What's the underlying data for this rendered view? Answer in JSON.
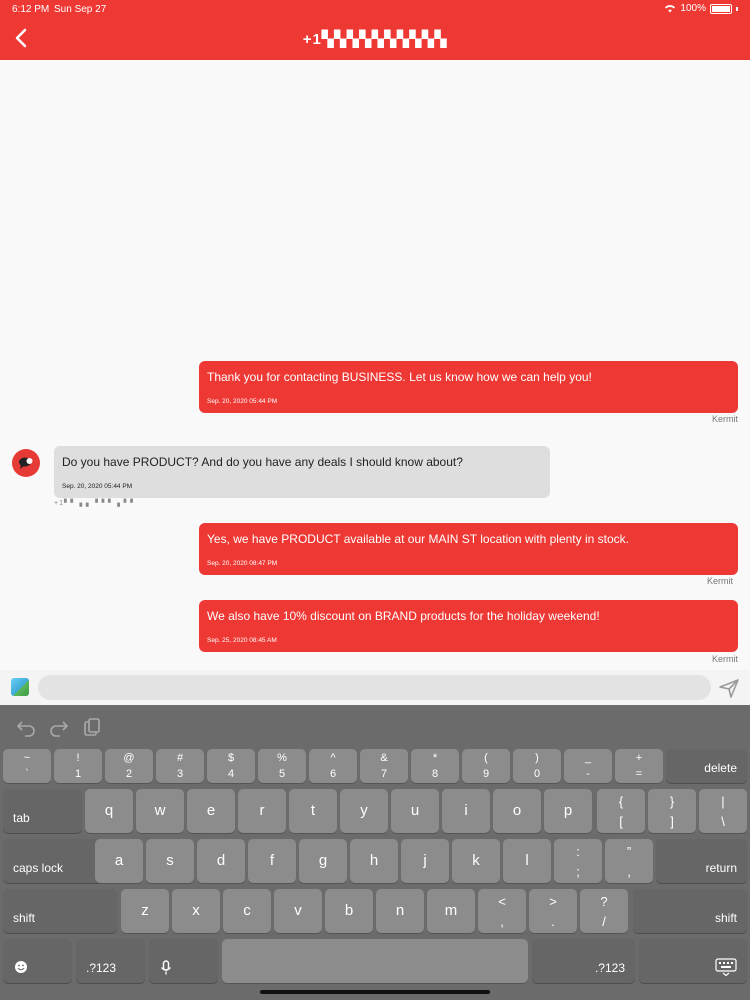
{
  "status_bar": {
    "time": "6:12 PM",
    "date": "Sun Sep 27",
    "battery": "100%"
  },
  "header": {
    "title": "+1▚▚▚▚▚▚▚▚▚▚"
  },
  "messages": [
    {
      "direction": "out",
      "text": "Thank you for contacting BUSINESS. Let us know how we can help you!",
      "time": "Sep. 20, 2020 05:44 PM",
      "sender": "Kermit"
    },
    {
      "direction": "in",
      "text": "Do you have PRODUCT? And do you have any deals I should know about?",
      "time": "Sep. 20, 2020 05:44 PM",
      "sender_meta": "+1▘▘▗▗ ▝▝▝ ▗▝ ▘"
    },
    {
      "direction": "out",
      "text": "Yes, we have PRODUCT available at our MAIN ST location with plenty in stock.",
      "time": "Sep. 20, 2020 08:47 PM",
      "sender": "Kermit"
    },
    {
      "direction": "out",
      "text": "We also have 10% discount on BRAND products for the holiday weekend!",
      "time": "Sep. 25, 2020 08:45 AM",
      "sender": "Kermit"
    }
  ],
  "composer": {
    "value": "",
    "placeholder": ""
  },
  "keyboard": {
    "row1": [
      {
        "top": "~",
        "bot": "`"
      },
      {
        "top": "!",
        "bot": "1"
      },
      {
        "top": "@",
        "bot": "2"
      },
      {
        "top": "#",
        "bot": "3"
      },
      {
        "top": "$",
        "bot": "4"
      },
      {
        "top": "%",
        "bot": "5"
      },
      {
        "top": "^",
        "bot": "6"
      },
      {
        "top": "&",
        "bot": "7"
      },
      {
        "top": "*",
        "bot": "8"
      },
      {
        "top": "(",
        "bot": "9"
      },
      {
        "top": ")",
        "bot": "0"
      },
      {
        "top": "_",
        "bot": "-"
      },
      {
        "top": "+",
        "bot": "="
      }
    ],
    "delete": "delete",
    "tab": "tab",
    "row2": [
      "q",
      "w",
      "e",
      "r",
      "t",
      "y",
      "u",
      "i",
      "o",
      "p"
    ],
    "row2_sym": [
      {
        "top": "{",
        "bot": "["
      },
      {
        "top": "}",
        "bot": "]"
      },
      {
        "top": "|",
        "bot": "\\"
      }
    ],
    "caps": "caps lock",
    "row3": [
      "a",
      "s",
      "d",
      "f",
      "g",
      "h",
      "j",
      "k",
      "l"
    ],
    "row3_sym": [
      {
        "top": ":",
        "bot": ";"
      },
      {
        "top": "”",
        "bot": ","
      }
    ],
    "return": "return",
    "shift": "shift",
    "row4": [
      "z",
      "x",
      "c",
      "v",
      "b",
      "n",
      "m"
    ],
    "row4_sym": [
      {
        "top": "<",
        "bot": ","
      },
      {
        "top": ">",
        "bot": "."
      },
      {
        "top": "?",
        "bot": "/"
      }
    ],
    "numbers": ".?123"
  },
  "colors": {
    "brand": "#ee3834",
    "incoming_bubble": "#dedede"
  }
}
